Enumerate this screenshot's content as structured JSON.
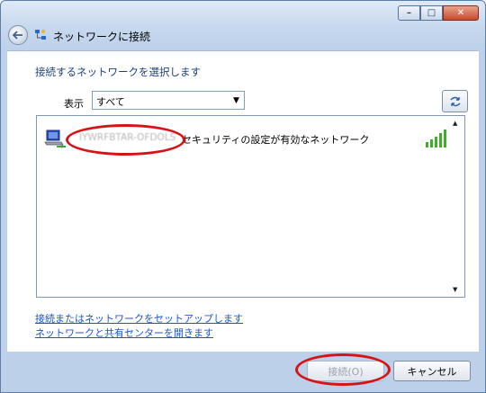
{
  "window": {
    "title": "ネットワークに接続",
    "controls": {
      "minimize": "–",
      "maximize": "□",
      "close": "✕"
    }
  },
  "content": {
    "heading": "接続するネットワークを選択します",
    "filter": {
      "label": "表示",
      "selected": "すべて"
    },
    "networks": [
      {
        "name": "IYWRFBTAR-OFDOLS",
        "security": "セキュリティの設定が有効なネットワーク",
        "icon": "wireless-network-icon",
        "signal": "signal-strength-full"
      }
    ],
    "links": [
      "接続またはネットワークをセットアップします",
      "ネットワークと共有センターを開きます"
    ]
  },
  "buttons": {
    "connect": "接続(O)",
    "cancel": "キャンセル"
  },
  "colors": {
    "annotation_circle": "#d61418",
    "link": "#1a58c8",
    "heading": "#1d3f7a"
  }
}
